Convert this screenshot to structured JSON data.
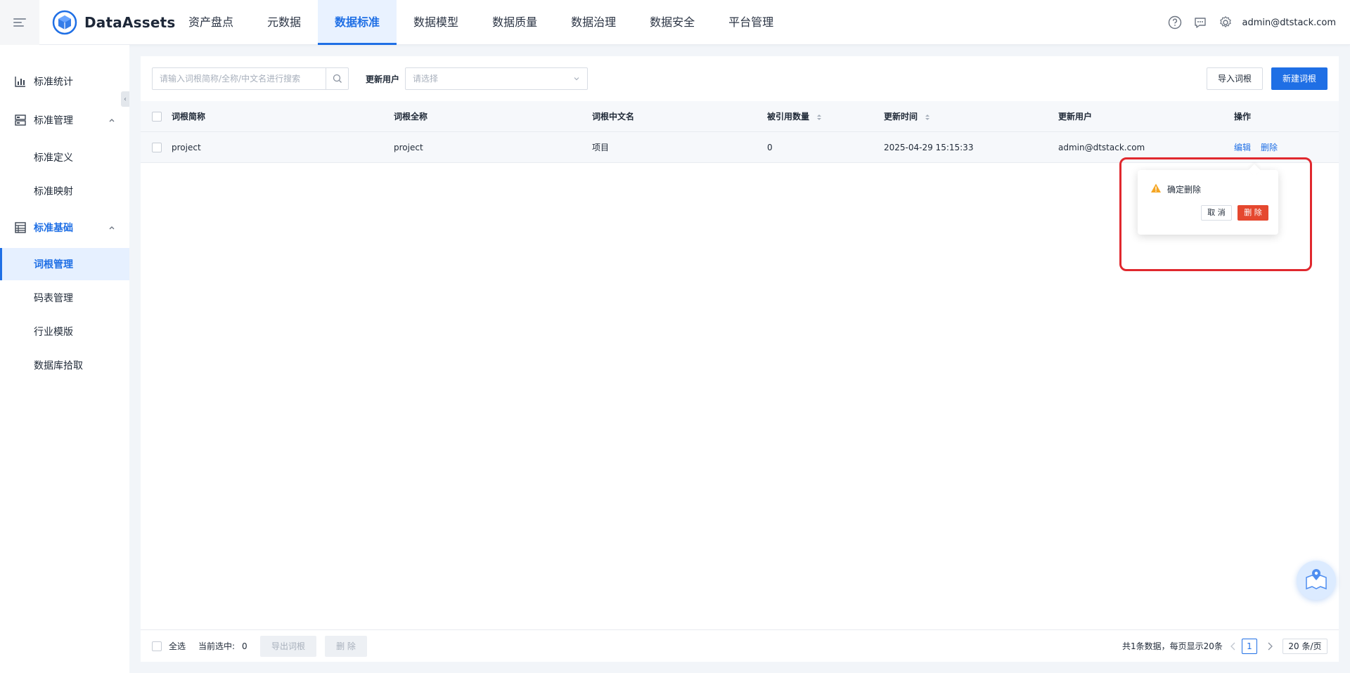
{
  "app": {
    "logo_text": "DataAssets"
  },
  "nav": {
    "items": [
      {
        "label": "资产盘点"
      },
      {
        "label": "元数据"
      },
      {
        "label": "数据标准"
      },
      {
        "label": "数据模型"
      },
      {
        "label": "数据质量"
      },
      {
        "label": "数据治理"
      },
      {
        "label": "数据安全"
      },
      {
        "label": "平台管理"
      }
    ],
    "active": "数据标准"
  },
  "header": {
    "user": "admin@dtstack.com"
  },
  "sidebar": {
    "collapse_glyph": "‹",
    "items": [
      {
        "label": "标准统计"
      },
      {
        "label": "标准管理"
      },
      {
        "label": "标准定义"
      },
      {
        "label": "标准映射"
      },
      {
        "label": "标准基础"
      },
      {
        "label": "词根管理"
      },
      {
        "label": "码表管理"
      },
      {
        "label": "行业模版"
      },
      {
        "label": "数据库拾取"
      }
    ]
  },
  "toolbar": {
    "search_placeholder": "请输入词根简称/全称/中文名进行搜索",
    "filter_label": "更新用户",
    "select_placeholder": "请选择",
    "import_label": "导入词根",
    "new_label": "新建词根"
  },
  "table": {
    "columns": [
      "词根简称",
      "词根全称",
      "词根中文名",
      "被引用数量",
      "更新时间",
      "更新用户",
      "操作"
    ],
    "rows": [
      {
        "short_name": "project",
        "full_name": "project",
        "cn_name": "项目",
        "ref_count": "0",
        "updated_at": "2025-04-29 15:15:33",
        "updated_by": "admin@dtstack.com",
        "edit": "编辑",
        "delete": "删除"
      }
    ]
  },
  "popconfirm": {
    "title": "确定删除",
    "cancel": "取 消",
    "ok": "删 除"
  },
  "footer": {
    "select_all": "全选",
    "selected_label": "当前选中:",
    "selected_count": "0",
    "export_label": "导出词根",
    "delete_label": "删 除",
    "total_text": "共1条数据，每页显示20条",
    "current_page": "1",
    "page_size": "20 条/页"
  },
  "colors": {
    "accent": "#1f6fe5",
    "danger": "#e5482f",
    "highlight": "#e0282e",
    "warning": "#f5a623"
  }
}
